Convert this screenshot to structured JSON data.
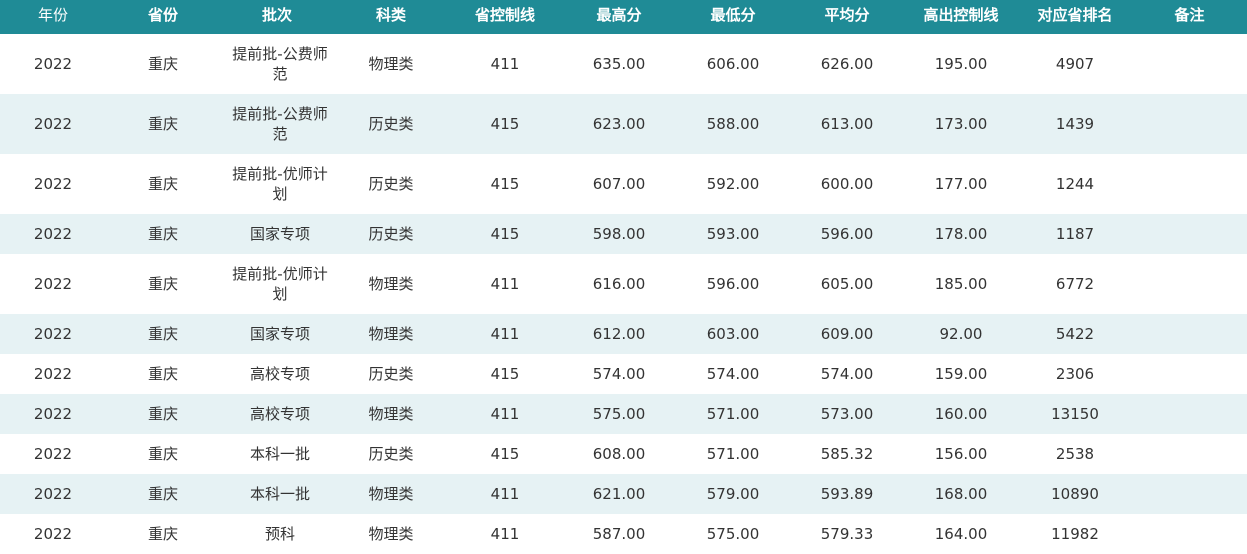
{
  "table": {
    "headers": [
      "年份",
      "省份",
      "批次",
      "科类",
      "省控制线",
      "最高分",
      "最低分",
      "平均分",
      "高出控制线",
      "对应省排名",
      "备注"
    ],
    "rows": [
      {
        "year": "2022",
        "province": "重庆",
        "batch": "提前批-公费师范",
        "category": "物理类",
        "control_line": "411",
        "max": "635.00",
        "min": "606.00",
        "avg": "626.00",
        "above": "195.00",
        "rank": "4907",
        "note": ""
      },
      {
        "year": "2022",
        "province": "重庆",
        "batch": "提前批-公费师范",
        "category": "历史类",
        "control_line": "415",
        "max": "623.00",
        "min": "588.00",
        "avg": "613.00",
        "above": "173.00",
        "rank": "1439",
        "note": ""
      },
      {
        "year": "2022",
        "province": "重庆",
        "batch": "提前批-优师计划",
        "category": "历史类",
        "control_line": "415",
        "max": "607.00",
        "min": "592.00",
        "avg": "600.00",
        "above": "177.00",
        "rank": "1244",
        "note": ""
      },
      {
        "year": "2022",
        "province": "重庆",
        "batch": "国家专项",
        "category": "历史类",
        "control_line": "415",
        "max": "598.00",
        "min": "593.00",
        "avg": "596.00",
        "above": "178.00",
        "rank": "1187",
        "note": ""
      },
      {
        "year": "2022",
        "province": "重庆",
        "batch": "提前批-优师计划",
        "category": "物理类",
        "control_line": "411",
        "max": "616.00",
        "min": "596.00",
        "avg": "605.00",
        "above": "185.00",
        "rank": "6772",
        "note": ""
      },
      {
        "year": "2022",
        "province": "重庆",
        "batch": "国家专项",
        "category": "物理类",
        "control_line": "411",
        "max": "612.00",
        "min": "603.00",
        "avg": "609.00",
        "above": "92.00",
        "rank": "5422",
        "note": ""
      },
      {
        "year": "2022",
        "province": "重庆",
        "batch": "高校专项",
        "category": "历史类",
        "control_line": "415",
        "max": "574.00",
        "min": "574.00",
        "avg": "574.00",
        "above": "159.00",
        "rank": "2306",
        "note": ""
      },
      {
        "year": "2022",
        "province": "重庆",
        "batch": "高校专项",
        "category": "物理类",
        "control_line": "411",
        "max": "575.00",
        "min": "571.00",
        "avg": "573.00",
        "above": "160.00",
        "rank": "13150",
        "note": ""
      },
      {
        "year": "2022",
        "province": "重庆",
        "batch": "本科一批",
        "category": "历史类",
        "control_line": "415",
        "max": "608.00",
        "min": "571.00",
        "avg": "585.32",
        "above": "156.00",
        "rank": "2538",
        "note": ""
      },
      {
        "year": "2022",
        "province": "重庆",
        "batch": "本科一批",
        "category": "物理类",
        "control_line": "411",
        "max": "621.00",
        "min": "579.00",
        "avg": "593.89",
        "above": "168.00",
        "rank": "10890",
        "note": ""
      },
      {
        "year": "2022",
        "province": "重庆",
        "batch": "预科",
        "category": "物理类",
        "control_line": "411",
        "max": "587.00",
        "min": "575.00",
        "avg": "579.33",
        "above": "164.00",
        "rank": "11982",
        "note": ""
      }
    ]
  },
  "colors": {
    "header_bg": "#1f8b96",
    "stripe_bg": "#e6f2f4",
    "text": "#333333"
  }
}
